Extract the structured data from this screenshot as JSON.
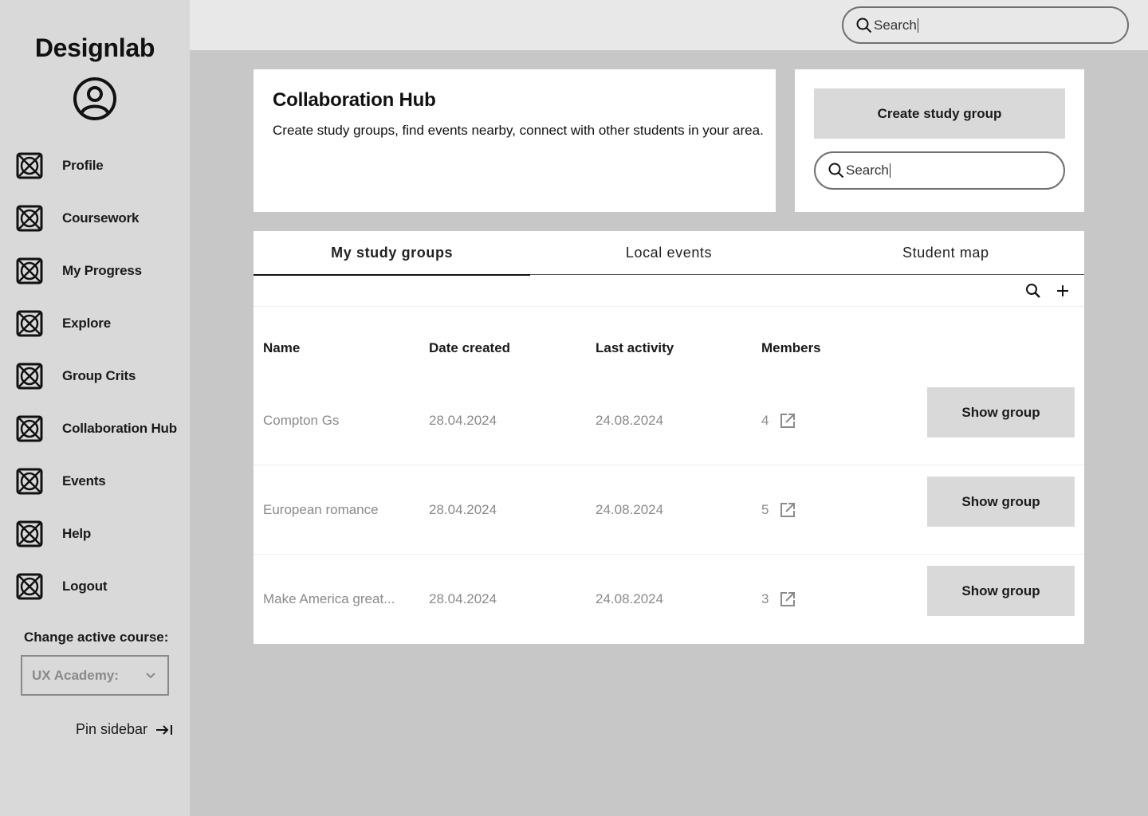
{
  "app": {
    "brand": "Designlab"
  },
  "sidebar": {
    "items": [
      {
        "label": "Profile"
      },
      {
        "label": "Coursework"
      },
      {
        "label": "My Progress"
      },
      {
        "label": "Explore"
      },
      {
        "label": "Group Crits"
      },
      {
        "label": "Collaboration Hub"
      },
      {
        "label": "Events"
      },
      {
        "label": "Help"
      },
      {
        "label": "Logout"
      }
    ],
    "course_label": "Change active course:",
    "course_value": "UX Academy:",
    "pin_label": "Pin sidebar"
  },
  "topbar": {
    "search_value": "Search"
  },
  "hub": {
    "title": "Collaboration Hub",
    "description": "Create study groups, find events nearby, connect with other students in your area.",
    "create_button": "Create study group",
    "search_value": "Search"
  },
  "tabs": [
    {
      "label": "My study groups",
      "active": true
    },
    {
      "label": "Local events",
      "active": false
    },
    {
      "label": "Student map",
      "active": false
    }
  ],
  "table": {
    "columns": [
      "Name",
      "Date created",
      "Last activity",
      "Members"
    ],
    "rows": [
      {
        "name": "Compton Gs",
        "created": "28.04.2024",
        "activity": "24.08.2024",
        "members": "4",
        "action": "Show group"
      },
      {
        "name": "European romance",
        "created": "28.04.2024",
        "activity": "24.08.2024",
        "members": "5",
        "action": "Show group"
      },
      {
        "name": "Make America great...",
        "created": "28.04.2024",
        "activity": "24.08.2024",
        "members": "3",
        "action": "Show group"
      }
    ]
  },
  "icons": {
    "nav": "placeholder-box-icon",
    "avatar": "user-circle-icon",
    "search": "search-icon",
    "add": "plus-icon",
    "external": "external-link-icon",
    "chevron": "chevron-down-icon",
    "pin": "arrow-right-to-bar-icon"
  }
}
